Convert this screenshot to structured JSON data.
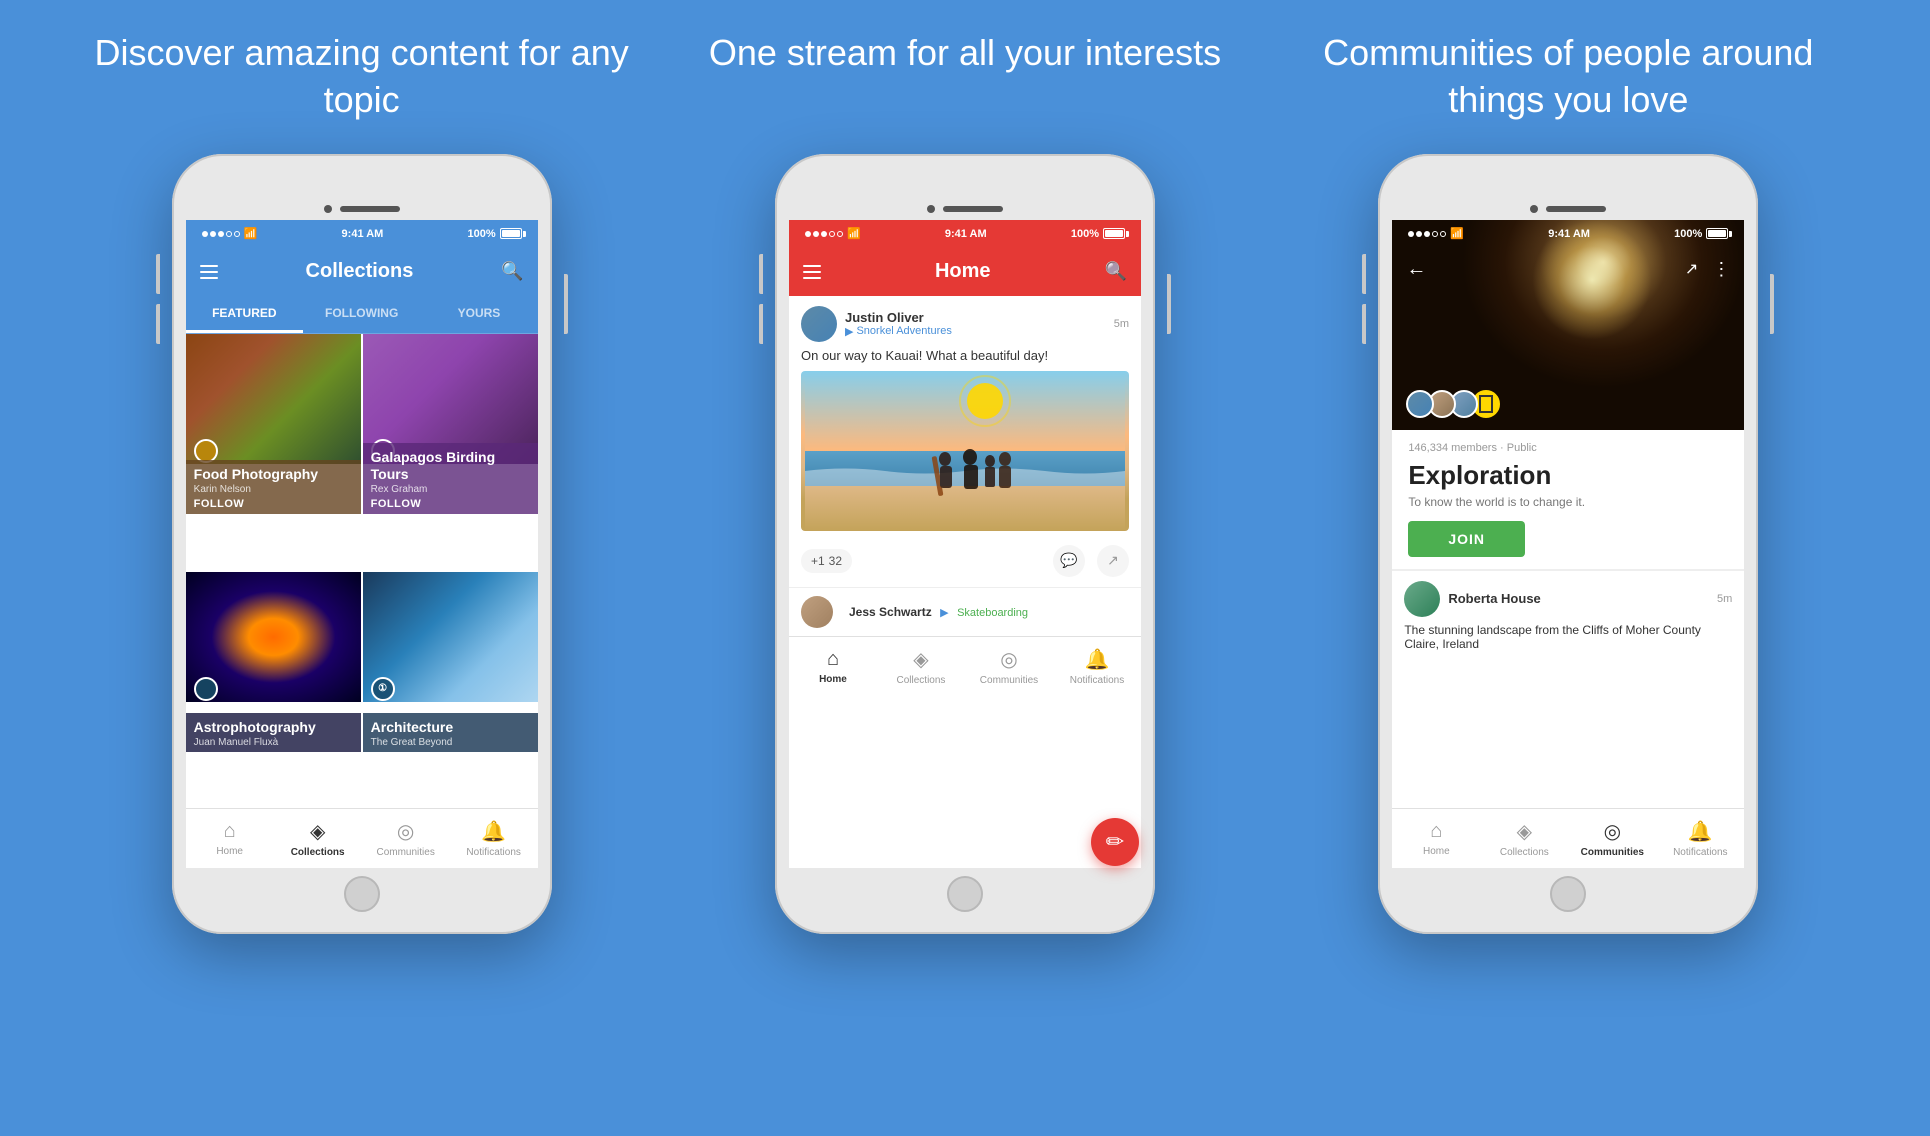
{
  "background_color": "#4A90D9",
  "taglines": [
    {
      "text": "Discover amazing content for any topic"
    },
    {
      "text": "One stream for all your interests"
    },
    {
      "text": "Communities of people around things you love"
    }
  ],
  "phone1": {
    "status": {
      "time": "9:41 AM",
      "battery": "100%"
    },
    "app_bar": {
      "title": "Collections",
      "color": "blue"
    },
    "tabs": [
      "FEATURED",
      "FOLLOWING",
      "YOURS"
    ],
    "active_tab": "FEATURED",
    "collections": [
      {
        "title": "Food Photography",
        "author": "Karin Nelson",
        "action": "FOLLOW",
        "bg": "food"
      },
      {
        "title": "Galapagos Birding Tours",
        "author": "Rex Graham",
        "action": "FOLLOW",
        "bg": "birds"
      },
      {
        "title": "Astrophotography",
        "author": "Juan Manuel Fluxà",
        "action": null,
        "bg": "astro"
      },
      {
        "title": "Architecture",
        "subtitle": "The Great Beyond",
        "action": null,
        "bg": "arch"
      }
    ],
    "bottom_nav": [
      {
        "label": "Home",
        "active": false
      },
      {
        "label": "Collections",
        "active": true
      },
      {
        "label": "Communities",
        "active": false
      },
      {
        "label": "Notifications",
        "active": false
      }
    ]
  },
  "phone2": {
    "status": {
      "time": "9:41 AM",
      "battery": "100%"
    },
    "app_bar": {
      "title": "Home",
      "color": "red"
    },
    "posts": [
      {
        "user": "Justin Oliver",
        "collection": "Snorkel Adventures",
        "time": "5m",
        "text": "On our way to Kauai! What a beautiful day!",
        "has_image": true,
        "likes": "+1",
        "comments": "32"
      },
      {
        "user": "Jess Schwartz",
        "collection": "Skateboarding",
        "time": ""
      }
    ],
    "bottom_nav": [
      {
        "label": "Home",
        "active": true
      },
      {
        "label": "Collections",
        "active": false
      },
      {
        "label": "Communities",
        "active": false
      },
      {
        "label": "Notifications",
        "active": false
      }
    ]
  },
  "phone3": {
    "status": {
      "time": "9:41 AM",
      "battery": "100%"
    },
    "community": {
      "members": "146,334 members · Public",
      "name": "Exploration",
      "description": "To know the world is to change it.",
      "join_label": "JOIN"
    },
    "post": {
      "user": "Roberta House",
      "time": "5m",
      "text": "The stunning landscape from the Cliffs of Moher County Claire, Ireland"
    },
    "bottom_nav": [
      {
        "label": "Home",
        "active": false
      },
      {
        "label": "Collections",
        "active": false
      },
      {
        "label": "Communities",
        "active": true
      },
      {
        "label": "Notifications",
        "active": false
      }
    ]
  },
  "icons": {
    "home": "⌂",
    "collections": "◈",
    "communities": "◎",
    "notifications": "🔔",
    "search": "🔍",
    "menu": "☰",
    "back": "←",
    "share": "↗",
    "more": "⋮",
    "edit": "✏",
    "plus": "+",
    "comment": "💬",
    "forward": "▶",
    "chevron": "▸"
  }
}
